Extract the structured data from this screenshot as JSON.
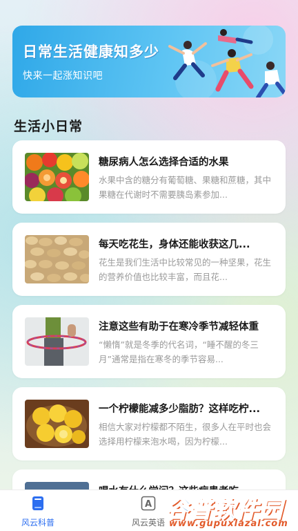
{
  "banner": {
    "title": "日常生活健康知多少",
    "subtitle": "快来一起涨知识吧"
  },
  "section": {
    "title": "生活小日常"
  },
  "articles": [
    {
      "title": "糖尿病人怎么选择合适的水果",
      "desc": "水果中含的糖分有葡萄糖、果糖和蔗糖，其中果糖在代谢时不需要胰岛素参加...",
      "thumb": "fruits"
    },
    {
      "title": "每天吃花生，身体还能收获这几...",
      "desc": "花生是我们生活中比较常见的一种坚果，花生的营养价值也比较丰富，而且花...",
      "thumb": "peanuts"
    },
    {
      "title": "注意这些有助于在寒冷季节减轻体重",
      "desc": "“懒惰”就是冬季的代名词，“睡不醒的冬三月”通常是指在寒冬的季节容易...",
      "thumb": "hula-hoop"
    },
    {
      "title": "一个柠檬能减多少脂肪？这样吃柠...",
      "desc": "相信大家对柠檬都不陌生，很多人在平时也会选择用柠檬来泡水喝，因为柠檬...",
      "thumb": "lemons"
    },
    {
      "title": "喝水有什么学问？这些病患者吃...",
      "desc": "",
      "thumb": "water"
    }
  ],
  "nav": {
    "items": [
      {
        "label": "风云科普",
        "icon": "book-icon",
        "active": true
      },
      {
        "label": "风云英语",
        "icon": "letter-a-icon",
        "active": false
      }
    ]
  },
  "watermark": {
    "brand": "谷普软件园",
    "url": "www.gupuxlazal.com"
  },
  "colors": {
    "accent": "#2c6ef0",
    "banner": "#3fb1ec"
  }
}
